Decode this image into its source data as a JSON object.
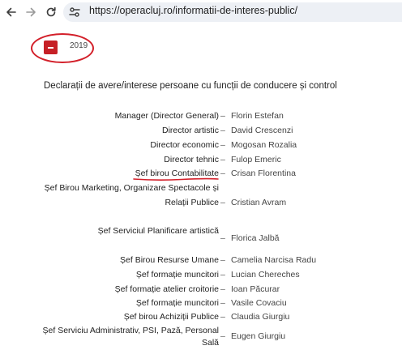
{
  "browser": {
    "url": "https://operacluj.ro/informatii-de-interes-public/",
    "icons": {
      "back": "arrow-left-icon",
      "forward": "arrow-right-icon",
      "reload": "reload-icon",
      "site_info": "tune-icon"
    }
  },
  "section": {
    "year": "2019",
    "heading": "Declarații de avere/interese persoane cu funcții de conducere și control",
    "accent_color": "#c62026"
  },
  "roles": [
    {
      "role": "Manager (Director General)",
      "person": "Florin Estefan"
    },
    {
      "role": "Director artistic",
      "person": "David Crescenzi"
    },
    {
      "role": "Director economic",
      "person": "Mogosan Rozalia"
    },
    {
      "role": "Director tehnic",
      "person": "Fulop Emeric"
    },
    {
      "role": "Șef birou Contabilitate",
      "person": "Crisan Florentina"
    },
    {
      "role_line1": "Șef Birou Marketing, Organizare Spectacole și",
      "role_line2": "Relații Publice",
      "person": "Cristian Avram"
    },
    {
      "role": "Șef Serviciul Planificare artistică",
      "person": "Florica Jalbă"
    },
    {
      "role": "Șef Birou Resurse Umane",
      "person": "Camelia Narcisa Radu"
    },
    {
      "role": "Șef formație muncitori",
      "person": "Lucian Chereches"
    },
    {
      "role": "Șef formație atelier croitorie",
      "person": "Ioan Păcurar"
    },
    {
      "role": "Șef formație muncitori",
      "person": "Vasile Covaciu"
    },
    {
      "role": "Șef birou Achiziții Publice",
      "person": "Claudia Giurgiu"
    },
    {
      "role_line1": "Șef Serviciu Administrativ, PSI, Pază, Personal",
      "role_line2": "Sală",
      "person": "Eugen Giurgiu"
    }
  ],
  "dash": "–"
}
